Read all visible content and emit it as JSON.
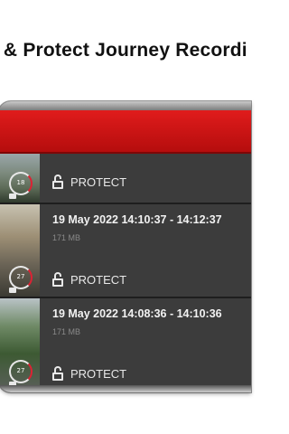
{
  "headline": "e & Protect Journey Recordi",
  "recordings": [
    {
      "title": "",
      "size": "",
      "speed": "18",
      "protect_label": "PROTECT",
      "lock_icon": "unlock-icon"
    },
    {
      "title": "19 May 2022 14:10:37 - 14:12:37",
      "size": "171 MB",
      "speed": "27",
      "protect_label": "PROTECT",
      "lock_icon": "unlock-icon"
    },
    {
      "title": "19 May 2022 14:08:36 - 14:10:36",
      "size": "171 MB",
      "speed": "27",
      "protect_label": "PROTECT",
      "lock_icon": "unlock-icon"
    }
  ],
  "colors": {
    "app_bar": "#d11414",
    "list_bg": "#3c3c3c",
    "text_primary": "#f2f2f2",
    "text_secondary": "#8a8a8a"
  }
}
